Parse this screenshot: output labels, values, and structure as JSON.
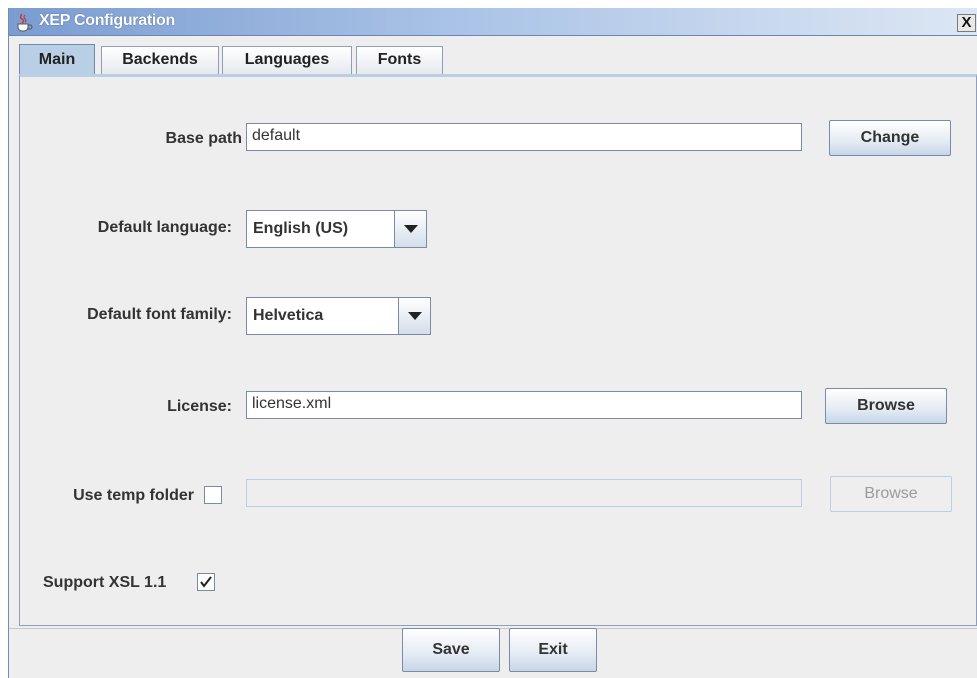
{
  "window": {
    "title": "XEP Configuration",
    "close_label": "X"
  },
  "tabs": [
    {
      "label": "Main",
      "active": true
    },
    {
      "label": "Backends",
      "active": false
    },
    {
      "label": "Languages",
      "active": false
    },
    {
      "label": "Fonts",
      "active": false
    }
  ],
  "main": {
    "base_path": {
      "label": "Base path",
      "value": "default",
      "button": "Change"
    },
    "default_language": {
      "label": "Default language:",
      "value": "English (US)"
    },
    "default_font_family": {
      "label": "Default font family:",
      "value": "Helvetica"
    },
    "license": {
      "label": "License:",
      "value": "license.xml",
      "button": "Browse"
    },
    "temp_folder": {
      "label": "Use temp folder",
      "checked": false,
      "value": "",
      "button": "Browse"
    },
    "support_xsl": {
      "label": "Support XSL 1.1",
      "checked": true
    }
  },
  "footer": {
    "save_label": "Save",
    "exit_label": "Exit"
  },
  "colors": {
    "accent": "#b8cfe5",
    "border": "#7a8aa8",
    "window_bg": "#eeeeee"
  }
}
